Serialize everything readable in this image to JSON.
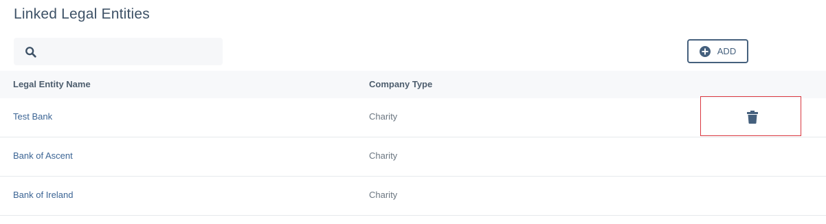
{
  "header": {
    "title": "Linked Legal Entities"
  },
  "search": {
    "value": "",
    "placeholder": "",
    "icon": "search-icon"
  },
  "toolbar": {
    "add_label": "ADD",
    "add_icon": "plus-circle-icon"
  },
  "table": {
    "columns": [
      "Legal Entity Name",
      "Company Type"
    ],
    "rows": [
      {
        "name": "Test Bank",
        "type": "Charity"
      },
      {
        "name": "Bank of Ascent",
        "type": "Charity"
      },
      {
        "name": "Bank of Ireland",
        "type": "Charity"
      }
    ],
    "row_action_icon": "trash-icon"
  },
  "colors": {
    "title": "#3d5166",
    "link": "#3b6494",
    "button": "#45607d",
    "highlight": "#d9363e",
    "header_bg": "#f7f8fa"
  }
}
